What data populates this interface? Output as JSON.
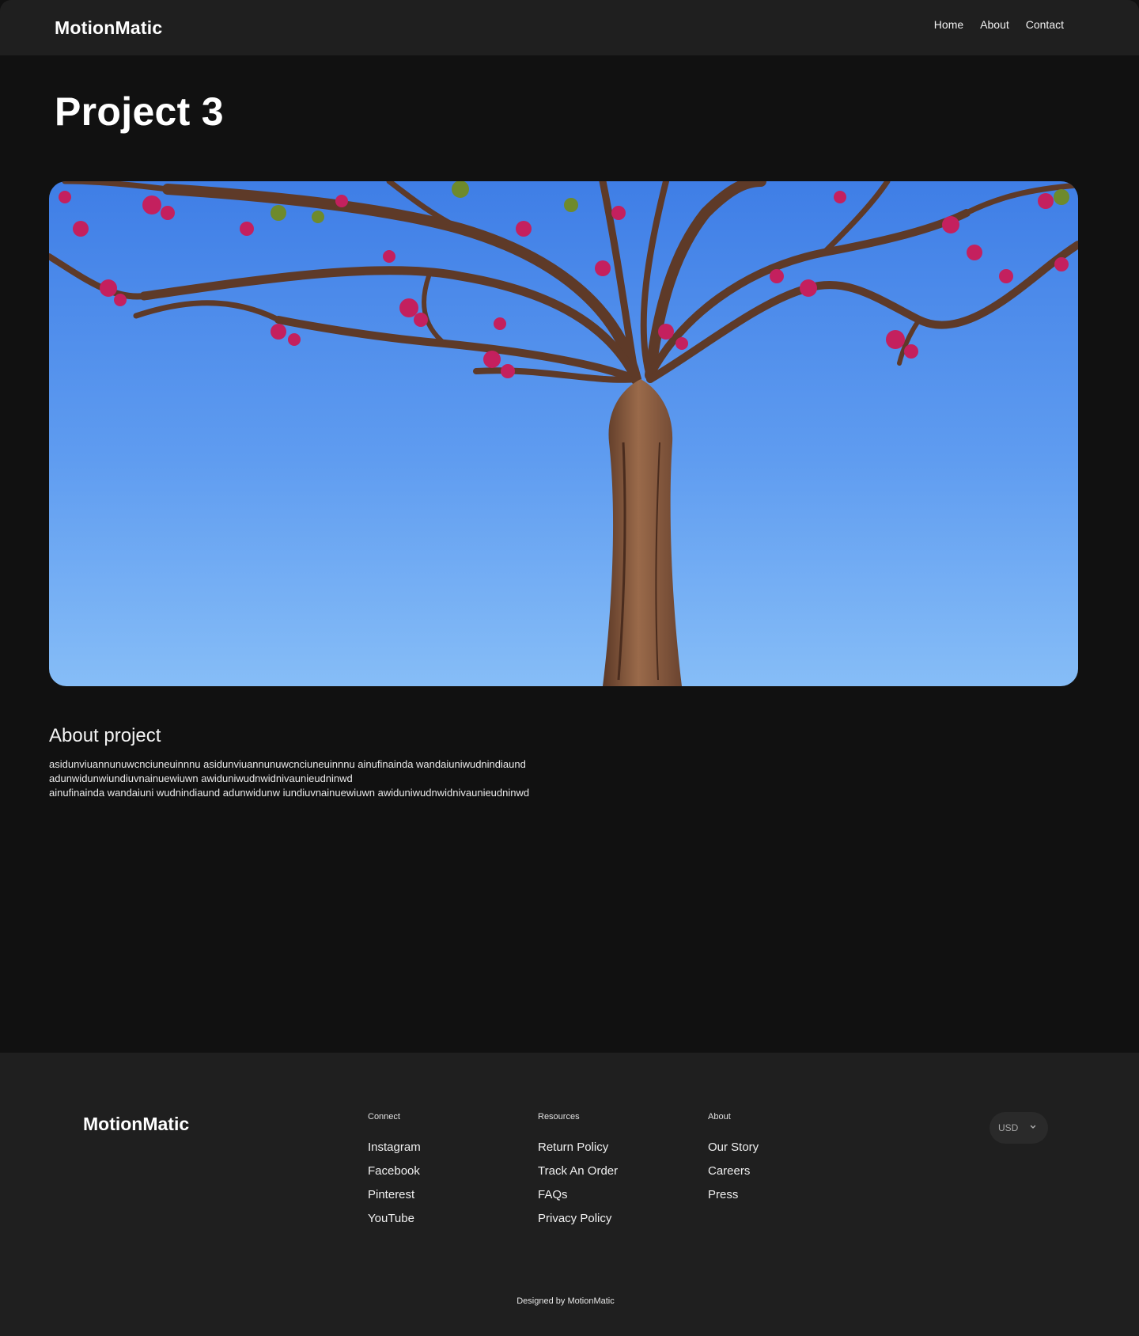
{
  "header": {
    "brand": "MotionMatic",
    "nav": [
      "Home",
      "About",
      "Contact"
    ]
  },
  "main": {
    "title": "Project 3",
    "hero_image": "tree-against-blue-sky",
    "about_heading": "About project",
    "description_lines": [
      "asidunviuannunuwcnciuneuinnnu asidunviuannunuwcnciuneuinnnu ainufinainda wandaiuniwudnindiaund",
      "adunwidunwiundiuvnainuewiuwn awiduniwudnwidnivaunieudninwd",
      "ainufinainda wandaiuni wudnindiaund adunwidunw iundiuvnainuewiuwn awiduniwudnwidnivaunieudninwd"
    ]
  },
  "footer": {
    "brand": "MotionMatic",
    "columns": [
      {
        "title": "Connect",
        "links": [
          "Instagram",
          "Facebook",
          "Pinterest",
          "YouTube"
        ]
      },
      {
        "title": "Resources",
        "links": [
          "Return Policy",
          "Track An Order",
          "FAQs",
          "Privacy Policy"
        ]
      },
      {
        "title": "About",
        "links": [
          "Our Story",
          "Careers",
          "Press"
        ]
      }
    ],
    "currency": {
      "value": "USD",
      "icon": "chevron-down-icon"
    },
    "credit": "Designed by MotionMatic"
  },
  "colors": {
    "background": "#111111",
    "surface": "#1f1f1f",
    "sky_top": "#3f7ee6",
    "sky_bottom": "#86bdf7",
    "trunk": "#8a5a3c",
    "blossom": "#c4205e"
  }
}
